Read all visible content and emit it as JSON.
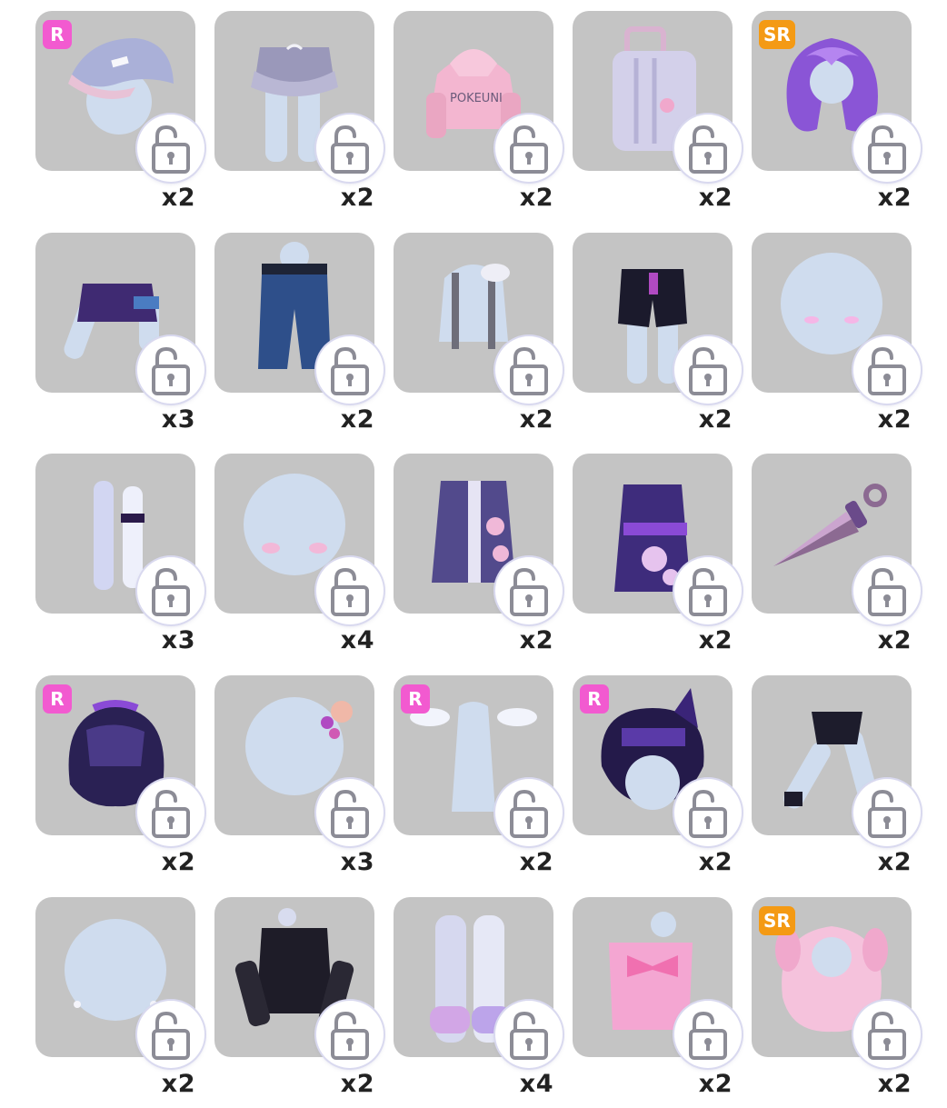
{
  "lock_icon": "unlock-icon",
  "colors": {
    "tile_bg": "#c4c4c4",
    "badge_r": "#f25ad0",
    "badge_sr": "#f49a14"
  },
  "items": [
    {
      "rarity": "R",
      "qty": "x2",
      "icon": "cap-icon"
    },
    {
      "rarity": "",
      "qty": "x2",
      "icon": "ruffle-skirt-icon"
    },
    {
      "rarity": "",
      "qty": "x2",
      "icon": "pink-hoodie-icon"
    },
    {
      "rarity": "",
      "qty": "x2",
      "icon": "suitcase-icon"
    },
    {
      "rarity": "SR",
      "qty": "x2",
      "icon": "purple-long-hair-icon"
    },
    {
      "rarity": "",
      "qty": "x3",
      "icon": "purple-crop-top-icon"
    },
    {
      "rarity": "",
      "qty": "x2",
      "icon": "denim-pants-icon"
    },
    {
      "rarity": "",
      "qty": "x2",
      "icon": "suspenders-icon"
    },
    {
      "rarity": "",
      "qty": "x2",
      "icon": "black-shorts-icon"
    },
    {
      "rarity": "",
      "qty": "x2",
      "icon": "blush-face-icon"
    },
    {
      "rarity": "",
      "qty": "x3",
      "icon": "white-socks-icon"
    },
    {
      "rarity": "",
      "qty": "x4",
      "icon": "pink-blush-face-icon"
    },
    {
      "rarity": "",
      "qty": "x2",
      "icon": "floral-kimono-icon"
    },
    {
      "rarity": "",
      "qty": "x2",
      "icon": "kimono-dress-icon"
    },
    {
      "rarity": "",
      "qty": "x2",
      "icon": "kunai-icon"
    },
    {
      "rarity": "R",
      "qty": "x2",
      "icon": "dark-short-hair-icon"
    },
    {
      "rarity": "",
      "qty": "x3",
      "icon": "flower-hairpin-icon"
    },
    {
      "rarity": "R",
      "qty": "x2",
      "icon": "angel-wings-icon"
    },
    {
      "rarity": "R",
      "qty": "x2",
      "icon": "cat-ear-hood-icon"
    },
    {
      "rarity": "",
      "qty": "x2",
      "icon": "black-sleeves-icon"
    },
    {
      "rarity": "",
      "qty": "x2",
      "icon": "earrings-face-icon"
    },
    {
      "rarity": "",
      "qty": "x2",
      "icon": "black-lace-top-icon"
    },
    {
      "rarity": "",
      "qty": "x4",
      "icon": "star-slippers-icon"
    },
    {
      "rarity": "",
      "qty": "x2",
      "icon": "pink-bow-top-icon"
    },
    {
      "rarity": "SR",
      "qty": "x2",
      "icon": "pink-twin-tails-icon"
    }
  ]
}
